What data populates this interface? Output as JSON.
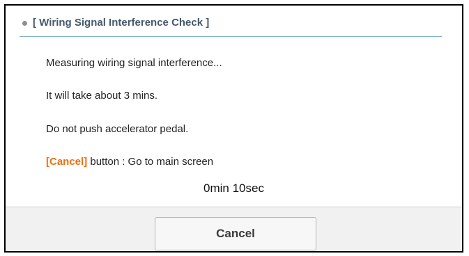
{
  "dialog": {
    "title": "[ Wiring Signal Interference Check ]",
    "messages": [
      "Measuring wiring signal interference...",
      "It will take about 3 mins.",
      "Do not push accelerator pedal."
    ],
    "cancel_hint": {
      "highlight": "[Cancel]",
      "text": " button : Go to main screen"
    },
    "timer": "0min 10sec",
    "cancel_button_label": "Cancel"
  },
  "colors": {
    "title_text": "#46586a",
    "header_rule": "#7eb2cf",
    "cancel_highlight": "#ee6f11",
    "footer_bg": "#f1f1f1"
  },
  "icons": {
    "header_bullet": "bullet-dot-icon"
  }
}
